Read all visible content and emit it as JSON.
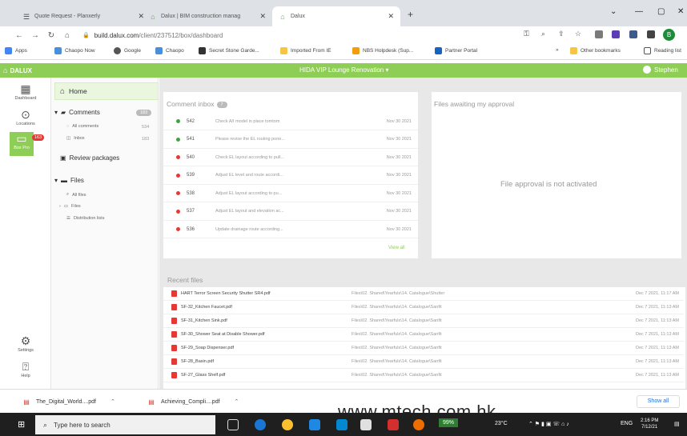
{
  "browser": {
    "tabs": [
      {
        "title": "Quote Request - Planxerly",
        "active": false
      },
      {
        "title": "Dalux | BIM construction manag",
        "active": false
      },
      {
        "title": "Dalux",
        "active": true
      }
    ],
    "url_host": "build.dalux.com",
    "url_path": "/client/237512/box/dashboard",
    "bookmarks": [
      "Apps",
      "Chaopo Now",
      "Google",
      "Chaopo",
      "Secret Stone Garde...",
      "Imported From IE",
      "NBS Holpdesk (Sup...",
      "Partner Portal"
    ],
    "other_bookmarks": "Other bookmarks",
    "reading_list": "Reading list",
    "profile_initial": "B"
  },
  "app": {
    "logo_text": "DALUX",
    "project_title": "HIDA VIP Lounge Renovation",
    "user_name": "Stephen"
  },
  "rail": {
    "items": [
      {
        "label": "Dashboard",
        "icon": "dashboard-icon"
      },
      {
        "label": "Locations",
        "icon": "location-pin-icon"
      },
      {
        "label": "Box Pro",
        "icon": "folder-icon",
        "badge": "163",
        "active": true
      },
      {
        "label": "Settings",
        "icon": "gear-icon"
      },
      {
        "label": "Help",
        "icon": "help-icon"
      }
    ]
  },
  "nav": {
    "home": "Home",
    "comments": "Comments",
    "comments_count": "183",
    "all_comments": "All comments",
    "all_comments_count": "534",
    "inbox": "Inbox",
    "inbox_count": "183",
    "review_packages": "Review packages",
    "files": "Files",
    "all_files": "All files",
    "files_sub": "Files",
    "distribution_lists": "Distribution lists"
  },
  "comment_inbox": {
    "title": "Comment inbox",
    "badge": "7",
    "view_all": "View all",
    "rows": [
      {
        "id": "542",
        "text": "Check A/I model in place tomtom",
        "date": "Nov 30 2021",
        "status": "green"
      },
      {
        "id": "541",
        "text": "Please revise the EL routing pone...",
        "date": "Nov 30 2021",
        "status": "green"
      },
      {
        "id": "540",
        "text": "Check EL layout according to pull...",
        "date": "Nov 30 2021",
        "status": "red"
      },
      {
        "id": "539",
        "text": "Adjust EL level and route accordi...",
        "date": "Nov 30 2021",
        "status": "red"
      },
      {
        "id": "538",
        "text": "Adjust EL layout according to pu...",
        "date": "Nov 30 2021",
        "status": "red"
      },
      {
        "id": "537",
        "text": "Adjust EL layout and elevation ac...",
        "date": "Nov 30 2021",
        "status": "red"
      },
      {
        "id": "536",
        "text": "Update drainage route according...",
        "date": "Nov 30 2021",
        "status": "red"
      }
    ]
  },
  "approval": {
    "title": "Files awaiting my approval",
    "message": "File approval is not activated"
  },
  "recent_files": {
    "title": "Recent files",
    "rows": [
      {
        "name": "HART Terror Screen Security Shutter SR4.pdf",
        "path": "Files\\02. Shared\\Yearfuls\\14. Catalogue\\Shutter",
        "date": "Dec 7 2021, 11:17 AM"
      },
      {
        "name": "SF-32_Kitchen Faucet.pdf",
        "path": "Files\\02. Shared\\Yearfuls\\14. Catalogue\\Sanfit",
        "date": "Dec 7 2021, 11:13 AM"
      },
      {
        "name": "SF-31_Kitchen Sink.pdf",
        "path": "Files\\02. Shared\\Yearfuls\\14. Catalogue\\Sanfit",
        "date": "Dec 7 2021, 11:13 AM"
      },
      {
        "name": "SF-30_Shower Seat at Disable Shower.pdf",
        "path": "Files\\02. Shared\\Yearfuls\\14. Catalogue\\Sanfit",
        "date": "Dec 7 2021, 11:13 AM"
      },
      {
        "name": "SF-29_Soap Dispenser.pdf",
        "path": "Files\\02. Shared\\Yearfuls\\14. Catalogue\\Sanfit",
        "date": "Dec 7 2021, 11:13 AM"
      },
      {
        "name": "SF-28_Basin.pdf",
        "path": "Files\\02. Shared\\Yearfuls\\14. Catalogue\\Sanfit",
        "date": "Dec 7 2021, 11:13 AM"
      },
      {
        "name": "SF-27_Glass Shelf.pdf",
        "path": "Files\\02. Shared\\Yearfuls\\14. Catalogue\\Sanfit",
        "date": "Dec 7 2021, 11:13 AM"
      }
    ]
  },
  "downloads": {
    "items": [
      "The_Digital_World....pdf",
      "Achieving_Compli....pdf"
    ],
    "show_all": "Show all"
  },
  "watermark": "www.mtech.com.hk",
  "taskbar": {
    "search_placeholder": "Type here to search",
    "battery": "99%",
    "temperature": "23°C",
    "language": "ENG",
    "time": "2:16 PM",
    "date": "7/12/21"
  },
  "colors": {
    "accent_green": "#8fce56",
    "status_red": "#e53935",
    "status_green": "#43a047"
  }
}
